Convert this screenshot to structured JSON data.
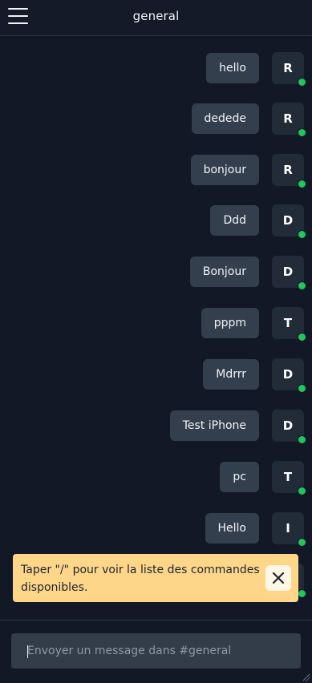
{
  "header": {
    "title": "general",
    "menu_icon": "hamburger-menu-icon"
  },
  "messages": [
    {
      "text": "hello",
      "avatar": "R",
      "online": true
    },
    {
      "text": "dedede",
      "avatar": "R",
      "online": true
    },
    {
      "text": "bonjour",
      "avatar": "R",
      "online": true
    },
    {
      "text": "Ddd",
      "avatar": "D",
      "online": true
    },
    {
      "text": "Bonjour",
      "avatar": "D",
      "online": true
    },
    {
      "text": "pppm",
      "avatar": "T",
      "online": true
    },
    {
      "text": "Mdrrr",
      "avatar": "D",
      "online": true
    },
    {
      "text": "Test iPhone",
      "avatar": "D",
      "online": true
    },
    {
      "text": "pc",
      "avatar": "T",
      "online": true
    },
    {
      "text": "Hello",
      "avatar": "I",
      "online": true
    }
  ],
  "hint": {
    "text": "Taper \"/\" pour voir la liste des commandes disponibles.",
    "close_icon": "close-icon"
  },
  "composer": {
    "placeholder": "Envoyer un message dans #general",
    "value": ""
  },
  "colors": {
    "background": "#121826",
    "bubble": "#343f4d",
    "avatar": "#222b38",
    "online": "#22c55e",
    "hint": "#fdd68a"
  }
}
